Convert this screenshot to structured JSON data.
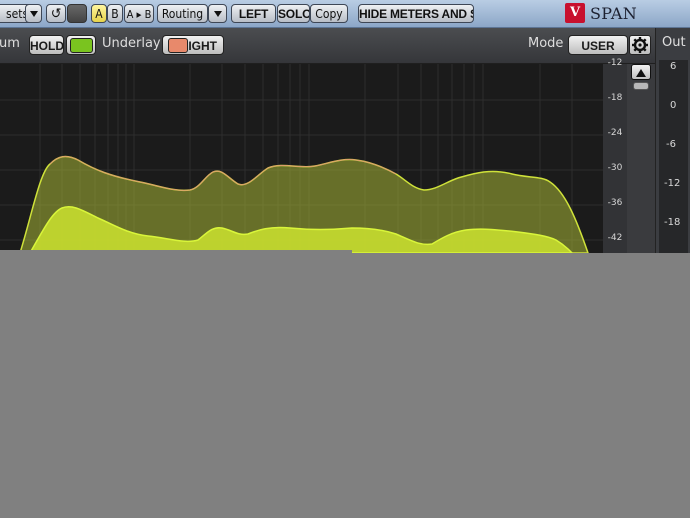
{
  "toolbar": {
    "presets_label": "sets",
    "ab_a": "A",
    "ab_b": "B",
    "ab_copy": "A ▸ B",
    "routing_label": "Routing",
    "left_label": "LEFT",
    "solo_label": "SOLO",
    "copy_label": "Copy",
    "hide_meters_label": "HIDE METERS AND STATS",
    "brand": "SPAN",
    "logo": "V"
  },
  "second_bar": {
    "truncated_label": "um",
    "hold_label": "HOLD",
    "underlay_label": "Underlay",
    "right_label": "RIGHT",
    "mode_label": "Mode",
    "mode_value": "USER"
  },
  "out_panel": {
    "label": "Out",
    "ticks": [
      "6",
      "0",
      "-6",
      "-12",
      "-18"
    ]
  },
  "db_scale": [
    "-12",
    "-18",
    "-24",
    "-30",
    "-36",
    "-42"
  ],
  "colors": {
    "accent_yellow": "#e6d34b",
    "hold_green": "#7ac41f",
    "underlay_salmon": "#e8896b",
    "spectrum_fill": "#c7dd2f",
    "spectrum_line": "#d9f53a"
  }
}
